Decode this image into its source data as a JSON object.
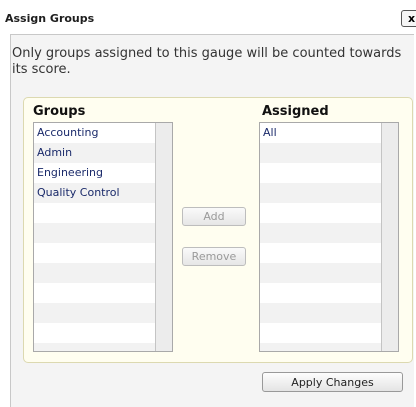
{
  "window": {
    "title": "Assign Groups",
    "close_label": "x"
  },
  "description": "Only groups assigned to this gauge will be counted towards its score.",
  "groups": {
    "heading": "Groups",
    "items": [
      "Accounting",
      "Admin",
      "Engineering",
      "Quality Control"
    ]
  },
  "assigned": {
    "heading": "Assigned",
    "items": [
      "All"
    ]
  },
  "buttons": {
    "add": "Add",
    "remove": "Remove",
    "apply": "Apply Changes"
  }
}
